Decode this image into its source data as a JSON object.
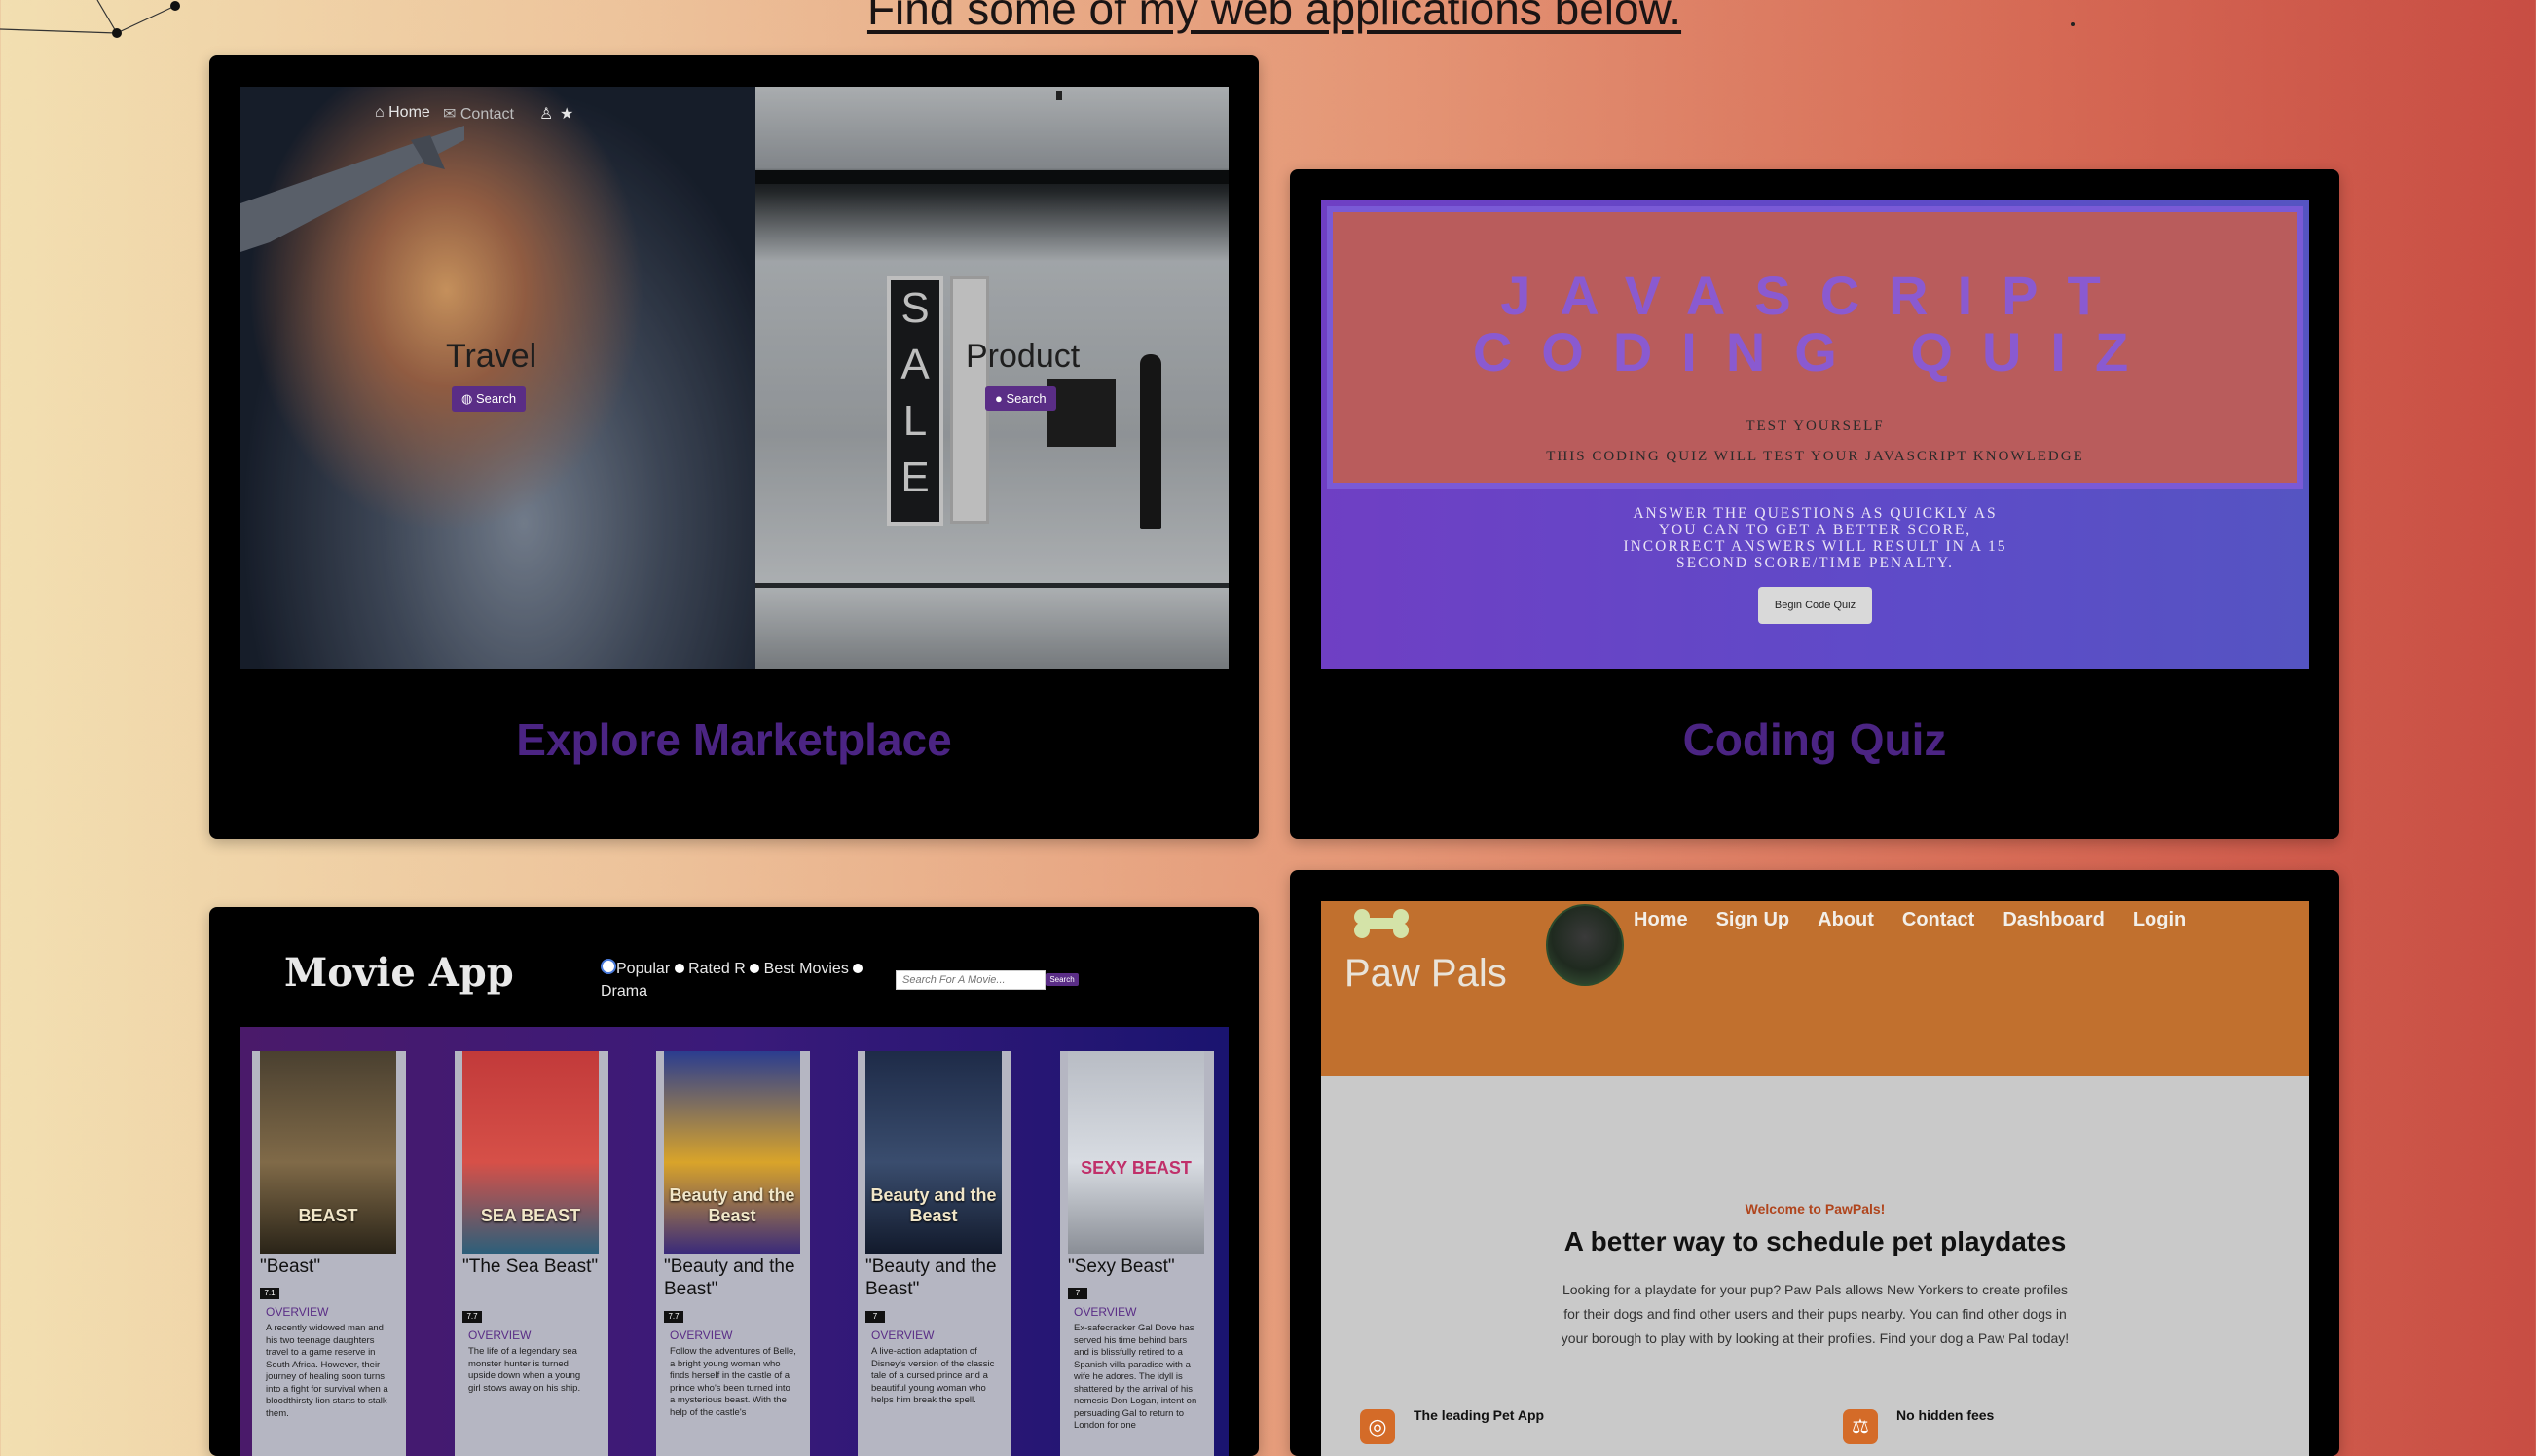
{
  "heading": "Find some of my web applications below.",
  "cards": {
    "marketplace": {
      "title": "Explore Marketplace",
      "nav": {
        "home": "Home",
        "contact": "Contact"
      },
      "travel": {
        "label": "Travel",
        "button": "Search"
      },
      "product": {
        "label": "Product",
        "button": "Search",
        "sale_letters": [
          "S",
          "A",
          "L",
          "E"
        ]
      }
    },
    "quiz": {
      "title": "Coding Quiz",
      "heading_line1": "JAVASCRIPT",
      "heading_line2": "CODING QUIZ",
      "sub1": "TEST YOURSELF",
      "sub2": "THIS CODING QUIZ WILL TEST YOUR JAVASCRIPT KNOWLEDGE",
      "instructions": [
        "ANSWER THE QUESTIONS AS QUICKLY AS",
        "YOU CAN TO GET A BETTER SCORE,",
        "INCORRECT ANSWERS WILL RESULT IN A 15",
        "SECOND SCORE/TIME PENALTY."
      ],
      "button": "Begin Code Quiz"
    },
    "movie": {
      "app_title": "Movie App",
      "filters": [
        "Popular",
        "Rated R",
        "Best Movies",
        "Drama"
      ],
      "search_placeholder": "Search For A Movie...",
      "search_button": "Search",
      "overview_label": "OVERVIEW",
      "movies": [
        {
          "title": "\"Beast\"",
          "rating": "7.1",
          "poster_text": "BEAST",
          "poster_colors": [
            "#4a4030",
            "#806a48",
            "#2a2418"
          ],
          "overview": "A recently widowed man and his two teenage daughters travel to a game reserve in South Africa. However, their journey of healing soon turns into a fight for survival when a bloodthirsty lion starts to stalk them."
        },
        {
          "title": "\"The Sea Beast\"",
          "rating": "7.7",
          "poster_text": "SEA BEAST",
          "poster_colors": [
            "#c23a3a",
            "#d65048",
            "#2c5f7a"
          ],
          "overview": "The life of a legendary sea monster hunter is turned upside down when a young girl stows away on his ship."
        },
        {
          "title": "\"Beauty and the Beast\"",
          "rating": "7.7",
          "poster_text": "Beauty and the Beast",
          "poster_colors": [
            "#2b3d8f",
            "#d9a42a",
            "#3a2a7a"
          ],
          "overview": "Follow the adventures of Belle, a bright young woman who finds herself in the castle of a prince who's been turned into a mysterious beast. With the help of the castle's"
        },
        {
          "title": "\"Beauty and the Beast\"",
          "rating": "7",
          "poster_text": "Beauty and the Beast",
          "poster_colors": [
            "#1e2b48",
            "#3a4d6e",
            "#121a2c"
          ],
          "overview": "A live-action adaptation of Disney's version of the classic tale of a cursed prince and a beautiful young woman who helps him break the spell."
        },
        {
          "title": "\"Sexy Beast\"",
          "rating": "7",
          "poster_text": "SEXY BEAST",
          "poster_colors": [
            "#b8bcc4",
            "#d8dce2",
            "#8a8e96"
          ],
          "overview": "Ex-safecracker Gal Dove has served his time behind bars and is blissfully retired to a Spanish villa paradise with a wife he adores. The idyll is shattered by the arrival of his nemesis Don Logan, intent on persuading Gal to return to London for one"
        }
      ]
    },
    "pawpals": {
      "brand": "Paw Pals",
      "nav": [
        "Home",
        "Sign Up",
        "About",
        "Contact",
        "Dashboard",
        "Login"
      ],
      "welcome": "Welcome to PawPals!",
      "headline": "A better way to schedule pet playdates",
      "body": [
        "Looking for a playdate for your pup? Paw Pals allows New Yorkers to create profiles",
        "for their dogs and find other users and their pups nearby. You can find other dogs in",
        "your borough to play with by looking at their profiles. Find your dog a Paw Pal today!"
      ],
      "feature1": "The leading Pet App",
      "feature2": "No hidden fees",
      "brand_color": "#c1702e"
    }
  }
}
